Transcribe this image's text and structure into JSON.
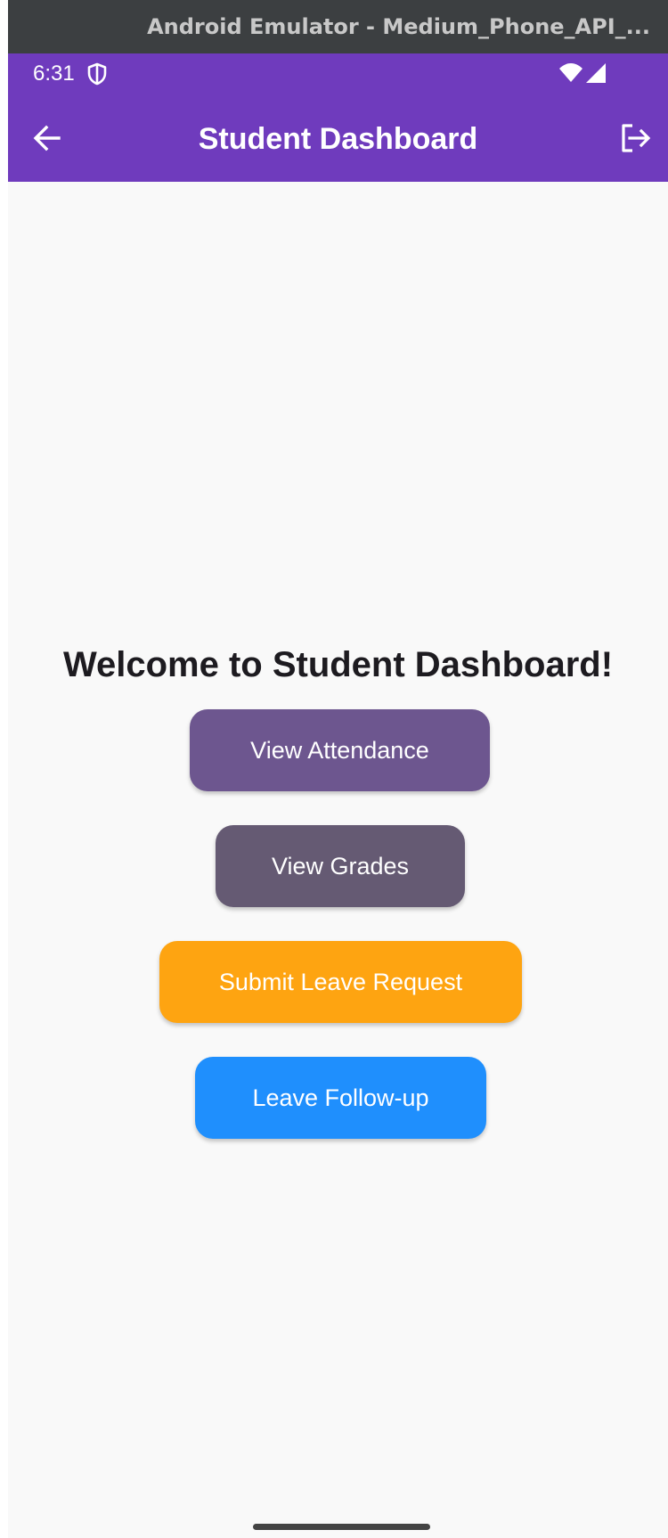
{
  "emulator": {
    "title": "Android Emulator - Medium_Phone_API_..."
  },
  "status_bar": {
    "time": "6:31"
  },
  "app_bar": {
    "title": "Student Dashboard"
  },
  "main": {
    "welcome": "Welcome to Student Dashboard!",
    "buttons": {
      "view_attendance": "View Attendance",
      "view_grades": "View Grades",
      "submit_leave": "Submit Leave Request",
      "leave_followup": "Leave Follow-up"
    }
  },
  "colors": {
    "app_bar": "#6f3bbd",
    "attendance_button": "#6d568f",
    "grades_button": "#655a73",
    "leave_button": "#fea411",
    "followup_button": "#1f8ffd",
    "background": "#f9f9f9"
  },
  "icons": {
    "back": "arrow-left-icon",
    "logout": "logout-icon",
    "status_shield": "shield-icon",
    "wifi": "wifi-icon",
    "signal": "signal-icon"
  }
}
